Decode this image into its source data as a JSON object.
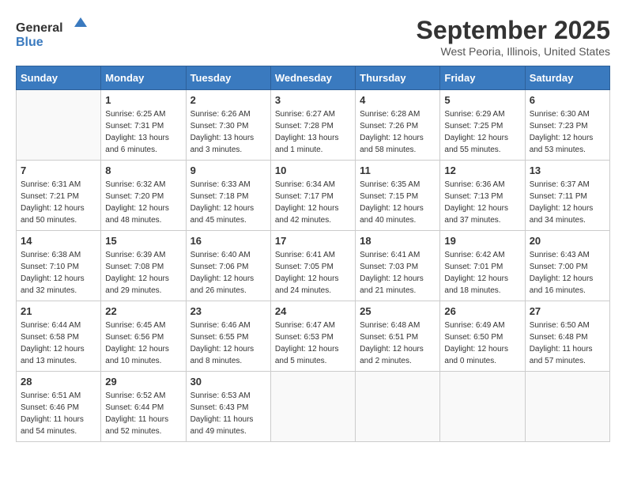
{
  "logo": {
    "general": "General",
    "blue": "Blue"
  },
  "title": "September 2025",
  "location": "West Peoria, Illinois, United States",
  "days_header": [
    "Sunday",
    "Monday",
    "Tuesday",
    "Wednesday",
    "Thursday",
    "Friday",
    "Saturday"
  ],
  "weeks": [
    [
      {
        "day": "",
        "sunrise": "",
        "sunset": "",
        "daylight": "",
        "empty": true
      },
      {
        "day": "1",
        "sunrise": "Sunrise: 6:25 AM",
        "sunset": "Sunset: 7:31 PM",
        "daylight": "Daylight: 13 hours and 6 minutes."
      },
      {
        "day": "2",
        "sunrise": "Sunrise: 6:26 AM",
        "sunset": "Sunset: 7:30 PM",
        "daylight": "Daylight: 13 hours and 3 minutes."
      },
      {
        "day": "3",
        "sunrise": "Sunrise: 6:27 AM",
        "sunset": "Sunset: 7:28 PM",
        "daylight": "Daylight: 13 hours and 1 minute."
      },
      {
        "day": "4",
        "sunrise": "Sunrise: 6:28 AM",
        "sunset": "Sunset: 7:26 PM",
        "daylight": "Daylight: 12 hours and 58 minutes."
      },
      {
        "day": "5",
        "sunrise": "Sunrise: 6:29 AM",
        "sunset": "Sunset: 7:25 PM",
        "daylight": "Daylight: 12 hours and 55 minutes."
      },
      {
        "day": "6",
        "sunrise": "Sunrise: 6:30 AM",
        "sunset": "Sunset: 7:23 PM",
        "daylight": "Daylight: 12 hours and 53 minutes."
      }
    ],
    [
      {
        "day": "7",
        "sunrise": "Sunrise: 6:31 AM",
        "sunset": "Sunset: 7:21 PM",
        "daylight": "Daylight: 12 hours and 50 minutes."
      },
      {
        "day": "8",
        "sunrise": "Sunrise: 6:32 AM",
        "sunset": "Sunset: 7:20 PM",
        "daylight": "Daylight: 12 hours and 48 minutes."
      },
      {
        "day": "9",
        "sunrise": "Sunrise: 6:33 AM",
        "sunset": "Sunset: 7:18 PM",
        "daylight": "Daylight: 12 hours and 45 minutes."
      },
      {
        "day": "10",
        "sunrise": "Sunrise: 6:34 AM",
        "sunset": "Sunset: 7:17 PM",
        "daylight": "Daylight: 12 hours and 42 minutes."
      },
      {
        "day": "11",
        "sunrise": "Sunrise: 6:35 AM",
        "sunset": "Sunset: 7:15 PM",
        "daylight": "Daylight: 12 hours and 40 minutes."
      },
      {
        "day": "12",
        "sunrise": "Sunrise: 6:36 AM",
        "sunset": "Sunset: 7:13 PM",
        "daylight": "Daylight: 12 hours and 37 minutes."
      },
      {
        "day": "13",
        "sunrise": "Sunrise: 6:37 AM",
        "sunset": "Sunset: 7:11 PM",
        "daylight": "Daylight: 12 hours and 34 minutes."
      }
    ],
    [
      {
        "day": "14",
        "sunrise": "Sunrise: 6:38 AM",
        "sunset": "Sunset: 7:10 PM",
        "daylight": "Daylight: 12 hours and 32 minutes."
      },
      {
        "day": "15",
        "sunrise": "Sunrise: 6:39 AM",
        "sunset": "Sunset: 7:08 PM",
        "daylight": "Daylight: 12 hours and 29 minutes."
      },
      {
        "day": "16",
        "sunrise": "Sunrise: 6:40 AM",
        "sunset": "Sunset: 7:06 PM",
        "daylight": "Daylight: 12 hours and 26 minutes."
      },
      {
        "day": "17",
        "sunrise": "Sunrise: 6:41 AM",
        "sunset": "Sunset: 7:05 PM",
        "daylight": "Daylight: 12 hours and 24 minutes."
      },
      {
        "day": "18",
        "sunrise": "Sunrise: 6:41 AM",
        "sunset": "Sunset: 7:03 PM",
        "daylight": "Daylight: 12 hours and 21 minutes."
      },
      {
        "day": "19",
        "sunrise": "Sunrise: 6:42 AM",
        "sunset": "Sunset: 7:01 PM",
        "daylight": "Daylight: 12 hours and 18 minutes."
      },
      {
        "day": "20",
        "sunrise": "Sunrise: 6:43 AM",
        "sunset": "Sunset: 7:00 PM",
        "daylight": "Daylight: 12 hours and 16 minutes."
      }
    ],
    [
      {
        "day": "21",
        "sunrise": "Sunrise: 6:44 AM",
        "sunset": "Sunset: 6:58 PM",
        "daylight": "Daylight: 12 hours and 13 minutes."
      },
      {
        "day": "22",
        "sunrise": "Sunrise: 6:45 AM",
        "sunset": "Sunset: 6:56 PM",
        "daylight": "Daylight: 12 hours and 10 minutes."
      },
      {
        "day": "23",
        "sunrise": "Sunrise: 6:46 AM",
        "sunset": "Sunset: 6:55 PM",
        "daylight": "Daylight: 12 hours and 8 minutes."
      },
      {
        "day": "24",
        "sunrise": "Sunrise: 6:47 AM",
        "sunset": "Sunset: 6:53 PM",
        "daylight": "Daylight: 12 hours and 5 minutes."
      },
      {
        "day": "25",
        "sunrise": "Sunrise: 6:48 AM",
        "sunset": "Sunset: 6:51 PM",
        "daylight": "Daylight: 12 hours and 2 minutes."
      },
      {
        "day": "26",
        "sunrise": "Sunrise: 6:49 AM",
        "sunset": "Sunset: 6:50 PM",
        "daylight": "Daylight: 12 hours and 0 minutes."
      },
      {
        "day": "27",
        "sunrise": "Sunrise: 6:50 AM",
        "sunset": "Sunset: 6:48 PM",
        "daylight": "Daylight: 11 hours and 57 minutes."
      }
    ],
    [
      {
        "day": "28",
        "sunrise": "Sunrise: 6:51 AM",
        "sunset": "Sunset: 6:46 PM",
        "daylight": "Daylight: 11 hours and 54 minutes."
      },
      {
        "day": "29",
        "sunrise": "Sunrise: 6:52 AM",
        "sunset": "Sunset: 6:44 PM",
        "daylight": "Daylight: 11 hours and 52 minutes."
      },
      {
        "day": "30",
        "sunrise": "Sunrise: 6:53 AM",
        "sunset": "Sunset: 6:43 PM",
        "daylight": "Daylight: 11 hours and 49 minutes."
      },
      {
        "day": "",
        "sunrise": "",
        "sunset": "",
        "daylight": "",
        "empty": true
      },
      {
        "day": "",
        "sunrise": "",
        "sunset": "",
        "daylight": "",
        "empty": true
      },
      {
        "day": "",
        "sunrise": "",
        "sunset": "",
        "daylight": "",
        "empty": true
      },
      {
        "day": "",
        "sunrise": "",
        "sunset": "",
        "daylight": "",
        "empty": true
      }
    ]
  ]
}
